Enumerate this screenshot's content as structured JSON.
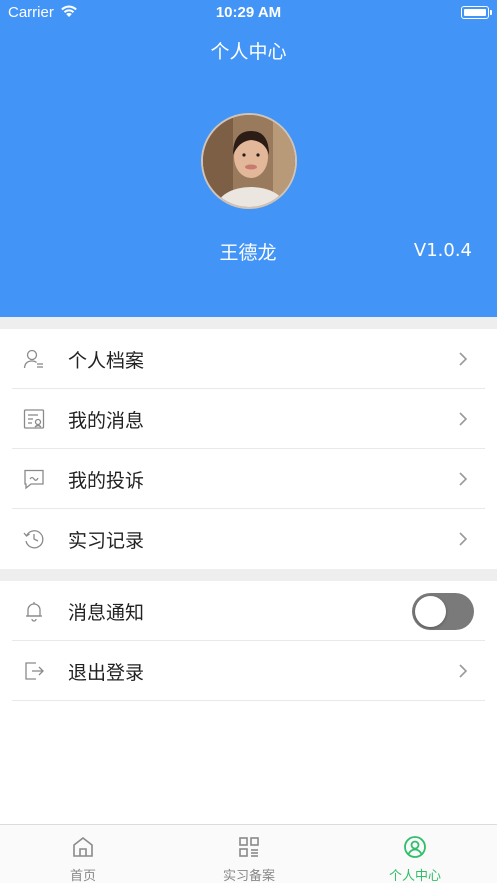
{
  "status_bar": {
    "carrier": "Carrier",
    "time": "10:29 AM"
  },
  "header": {
    "title": "个人中心",
    "user_name": "王德龙",
    "version": "V1.0.4"
  },
  "menu_group_1": [
    {
      "label": "个人档案",
      "icon": "user-profile-icon"
    },
    {
      "label": "我的消息",
      "icon": "message-doc-icon"
    },
    {
      "label": "我的投诉",
      "icon": "complaint-chat-icon"
    },
    {
      "label": "实习记录",
      "icon": "history-clock-icon"
    }
  ],
  "menu_group_2": [
    {
      "label": "消息通知",
      "icon": "bell-icon",
      "toggle_on": false
    },
    {
      "label": "退出登录",
      "icon": "logout-icon"
    }
  ],
  "tabbar": [
    {
      "label": "首页",
      "icon": "home-icon",
      "active": false
    },
    {
      "label": "实习备案",
      "icon": "qr-grid-icon",
      "active": false
    },
    {
      "label": "个人中心",
      "icon": "user-circle-icon",
      "active": true
    }
  ],
  "colors": {
    "header_bg": "#4294f7",
    "active_tab": "#2fbf6a",
    "toggle_off": "#7a7a7a"
  }
}
